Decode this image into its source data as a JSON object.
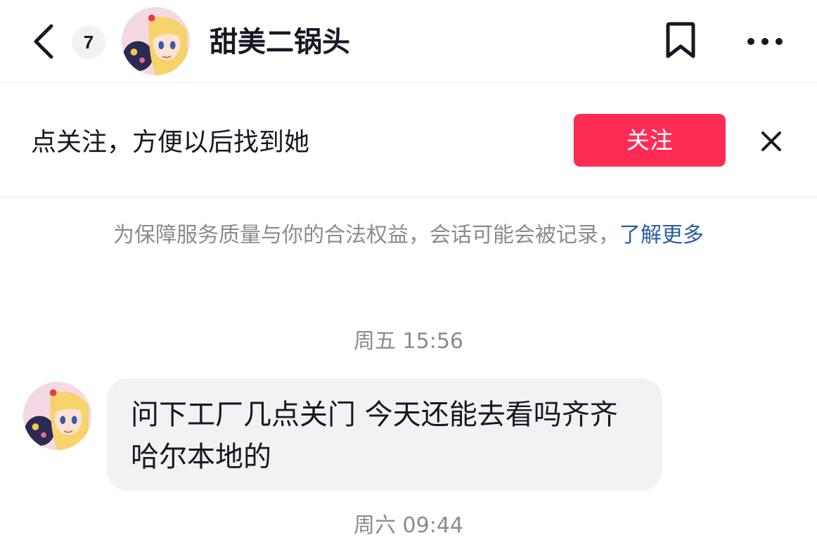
{
  "header": {
    "unread_count": "7",
    "contact_name": "甜美二锅头",
    "back_icon": "chevron-left-icon",
    "bookmark_icon": "bookmark-icon",
    "more_icon": "more-horizontal-icon"
  },
  "follow_bar": {
    "prompt": "点关注，方便以后找到她",
    "follow_label": "关注",
    "close_icon": "close-icon"
  },
  "notice": {
    "text": "为保障服务质量与你的合法权益，会话可能会被记录，",
    "link": "了解更多"
  },
  "messages": [
    {
      "timestamp": "周五 15:56",
      "text": "问下工厂几点关门 今天还能去看吗齐齐哈尔本地的"
    }
  ],
  "next_timestamp": "周六 09:44",
  "colors": {
    "accent": "#fe2c55",
    "link": "#2b5ca8",
    "bubble_bg": "#f2f2f4",
    "muted_text": "#8a8b91"
  }
}
